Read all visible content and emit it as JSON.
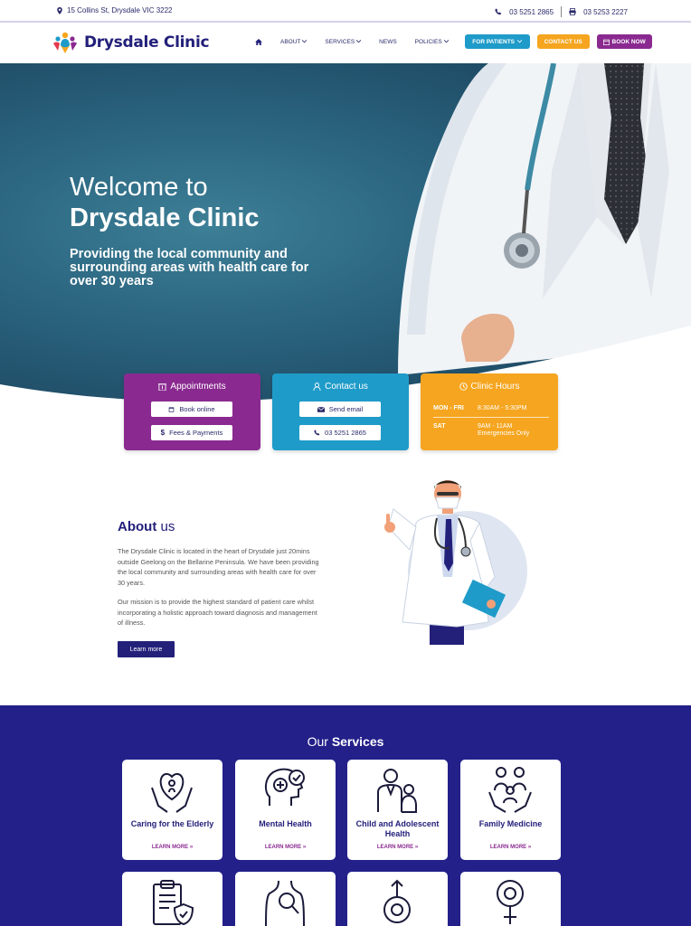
{
  "topbar": {
    "address": "15 Collins St, Drysdale VIC 3222",
    "phone": "03 5251 2865",
    "fax": "03 5253 2227"
  },
  "nav": {
    "logo_text": "Drysdale Clinic",
    "items": [
      {
        "label": "About",
        "has_dropdown": true
      },
      {
        "label": "Services",
        "has_dropdown": true
      },
      {
        "label": "News",
        "has_dropdown": false
      },
      {
        "label": "Policies",
        "has_dropdown": true
      }
    ],
    "for_patients": "For Patients",
    "contact_us": "Contact Us",
    "book_now": "Book Now"
  },
  "hero": {
    "welcome": "Welcome to",
    "clinic_name": "Drysdale Clinic",
    "tagline": "Providing the local community and surrounding areas with health care for over 30 years"
  },
  "cards": {
    "appointments": {
      "title": "Appointments",
      "book_online": "Book online",
      "fees": "Fees & Payments"
    },
    "contact": {
      "title": "Contact us",
      "send_email": "Send email",
      "phone": "03 5251 2865"
    },
    "hours": {
      "title": "Clinic Hours",
      "rows": [
        {
          "day": "MON - FRI",
          "time": "8:30AM - 5:30PM"
        },
        {
          "day": "SAT",
          "time": "9AM - 11AM Emergencies Only"
        }
      ]
    }
  },
  "about": {
    "title_a": "About",
    "title_b": "us",
    "p1": "The Drysdale Clinic is located in the heart of Drysdale just 20mins outside Geelong on the Bellarine Peninsula. We have been providing the local community and surrounding areas with health care for over 30 years.",
    "p2": "Our mission is to provide the highest standard of patient care whilst incorporating a holistic approach toward diagnosis and management of illness.",
    "learn_more": "Learn more"
  },
  "services": {
    "title_a": "Our",
    "title_b": "Services",
    "items": [
      {
        "label": "Caring for the Elderly",
        "more": "LEARN MORE »",
        "icon": "elderly-care-icon"
      },
      {
        "label": "Mental Health",
        "more": "LEARN MORE »",
        "icon": "mental-health-icon"
      },
      {
        "label": "Child and Adolescent Health",
        "more": "LEARN MORE »",
        "icon": "child-health-icon"
      },
      {
        "label": "Family Medicine",
        "more": "LEARN MORE »",
        "icon": "family-medicine-icon"
      }
    ]
  },
  "colors": {
    "navy": "#23207a",
    "purple": "#8a2a90",
    "blue": "#1f9bc9",
    "orange": "#f5a51f"
  }
}
